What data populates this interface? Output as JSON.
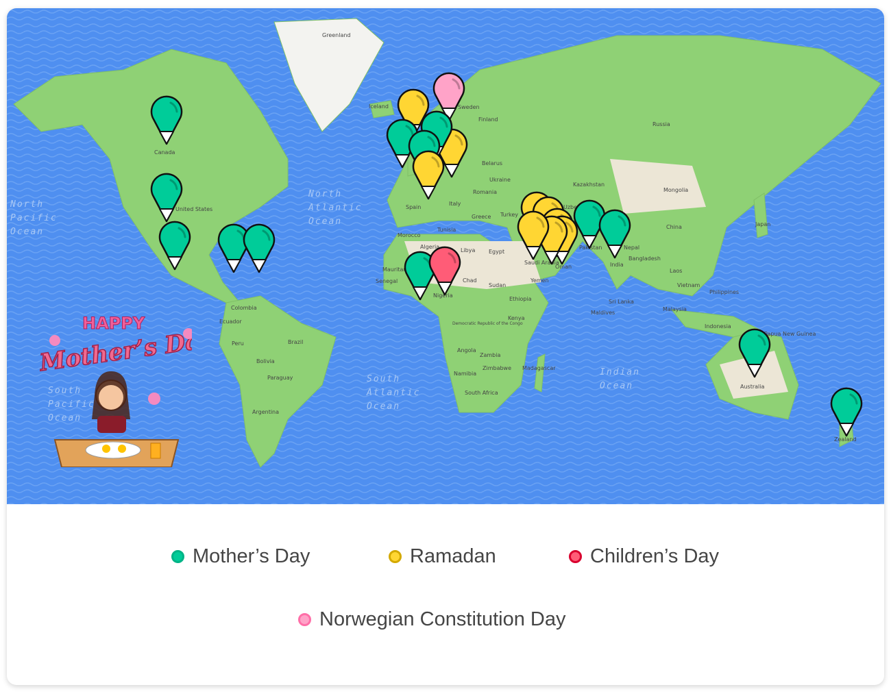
{
  "legend": [
    {
      "label": "Mother’s Day",
      "color": "#00cc99",
      "border": "#00b386"
    },
    {
      "label": "Ramadan",
      "color": "#ffd633",
      "border": "#d4a900"
    },
    {
      "label": "Children’s Day",
      "color": "#ff5c77",
      "border": "#d9002e"
    },
    {
      "label": "Norwegian Constitution Day",
      "color": "#ffa3c8",
      "border": "#ff6fa8"
    }
  ],
  "map": {
    "oceans": [
      "North Pacific Ocean",
      "North Atlantic Ocean",
      "South Atlantic Ocean",
      "Indian Ocean",
      "South Pacific Ocean"
    ],
    "countries": [
      "Greenland",
      "Iceland",
      "Sweden",
      "Finland",
      "Russia",
      "Canada",
      "United States",
      "Belarus",
      "Ukraine",
      "Kazakhstan",
      "Mongolia",
      "China",
      "Japan",
      "Romania",
      "Spain",
      "Italy",
      "Greece",
      "Turkey",
      "Tunisia",
      "Morocco",
      "Algeria",
      "Libya",
      "Egypt",
      "Mauritania",
      "Senegal",
      "Chad",
      "Sudan",
      "Nigeria",
      "Saudi Arabia",
      "Yemen",
      "Oman",
      "Pakistan",
      "Nepal",
      "India",
      "Bangladesh",
      "Laos",
      "Vietnam",
      "Philippines",
      "Malaysia",
      "Indonesia",
      "Sri Lanka",
      "Maldives",
      "Ethiopia",
      "Kenya",
      "Democratic Republic of the Congo",
      "Angola",
      "Zambia",
      "Namibia",
      "Zimbabwe",
      "Madagascar",
      "South Africa",
      "Colombia",
      "Ecuador",
      "Peru",
      "Brazil",
      "Bolivia",
      "Paraguay",
      "Argentina",
      "Papua New Guinea",
      "Australia",
      "Zealand",
      "Uzbe"
    ],
    "colors": {
      "ocean": "#4f8ff0",
      "land": "#8fd175",
      "desert": "#ece6d6"
    }
  },
  "sticker": {
    "line1": "HAPPY",
    "line2": "Mother’s Day"
  }
}
